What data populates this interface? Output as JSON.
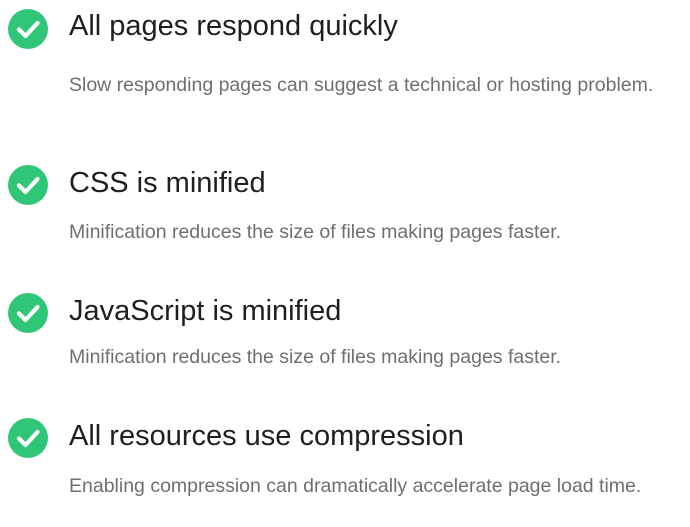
{
  "accent_color": "#2fc777",
  "icon": "check-circle-icon",
  "items": [
    {
      "title": "All pages respond quickly",
      "description": "Slow responding pages can suggest a technical or hosting problem."
    },
    {
      "title": "CSS is minified",
      "description": "Minification reduces the size of files making pages faster."
    },
    {
      "title": "JavaScript is minified",
      "description": "Minification reduces the size of files making pages faster."
    },
    {
      "title": "All resources use compression",
      "description": "Enabling compression can dramatically accelerate page load time."
    }
  ]
}
